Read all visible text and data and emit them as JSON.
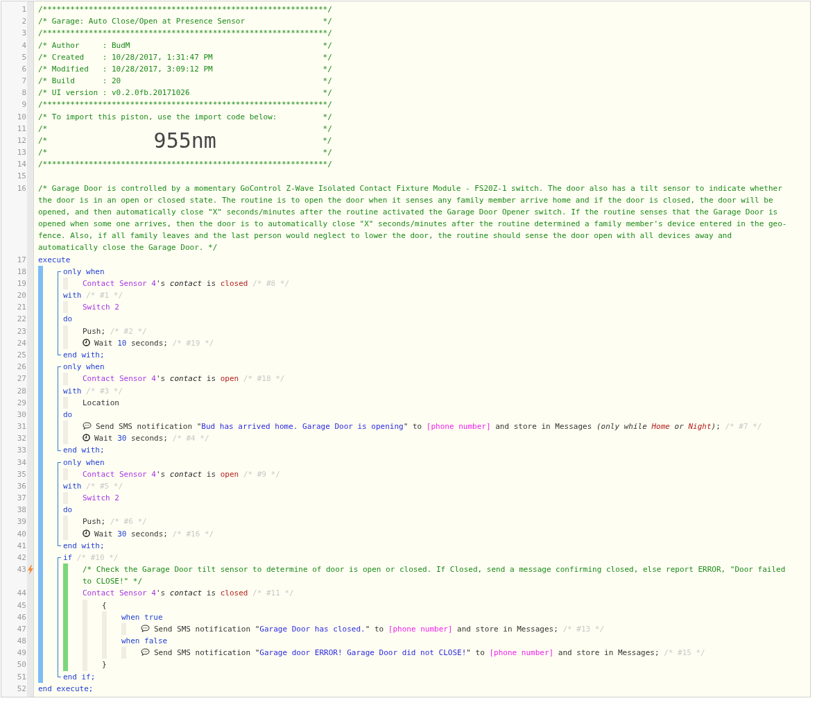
{
  "lines": [
    {
      "number": "1",
      "trigger": false,
      "tokens": [
        {
          "text": "/**************************************************************/",
          "kind": "comment"
        }
      ]
    },
    {
      "number": "2",
      "trigger": false,
      "tokens": [
        {
          "text": "/* Garage: Auto Close/Open at Presence Sensor                 */",
          "kind": "comment"
        }
      ]
    },
    {
      "number": "3",
      "trigger": false,
      "tokens": [
        {
          "text": "/**************************************************************/",
          "kind": "comment"
        }
      ]
    },
    {
      "number": "4",
      "trigger": false,
      "tokens": [
        {
          "text": "/* Author     : BudM                                          */",
          "kind": "comment"
        }
      ]
    },
    {
      "number": "5",
      "trigger": false,
      "tokens": [
        {
          "text": "/* Created    : 10/28/2017, 1:31:47 PM                        */",
          "kind": "comment"
        }
      ]
    },
    {
      "number": "6",
      "trigger": false,
      "tokens": [
        {
          "text": "/* Modified   : 10/28/2017, 3:09:12 PM                        */",
          "kind": "comment"
        }
      ]
    },
    {
      "number": "7",
      "trigger": false,
      "tokens": [
        {
          "text": "/* Build      : 20                                            */",
          "kind": "comment"
        }
      ]
    },
    {
      "number": "8",
      "trigger": false,
      "tokens": [
        {
          "text": "/* UI version : v0.2.0fb.20171026                             */",
          "kind": "comment"
        }
      ]
    },
    {
      "number": "9",
      "trigger": false,
      "tokens": [
        {
          "text": "/**************************************************************/",
          "kind": "comment"
        }
      ]
    },
    {
      "number": "10",
      "trigger": false,
      "tokens": [
        {
          "text": "/* To import this piston, use the import code below:          */",
          "kind": "comment"
        }
      ]
    },
    {
      "number": "11",
      "trigger": false,
      "tokens": [
        {
          "text": "/*                                                            */",
          "kind": "comment"
        }
      ]
    },
    {
      "number": "12",
      "trigger": false,
      "tokens": [
        {
          "text": "/*",
          "kind": "comment"
        },
        {
          "text": "955nm",
          "kind": "code"
        },
        {
          "text": "*/",
          "kind": "comment"
        }
      ]
    },
    {
      "number": "13",
      "trigger": false,
      "tokens": [
        {
          "text": "/*                                                            */",
          "kind": "comment"
        }
      ]
    },
    {
      "number": "14",
      "trigger": false,
      "tokens": [
        {
          "text": "/**************************************************************/",
          "kind": "comment"
        }
      ]
    },
    {
      "number": "15",
      "trigger": false
    },
    {
      "number": "16",
      "trigger": false,
      "tokens": [
        {
          "text": "/* Garage Door is controlled by a momentary GoControl Z-Wave Isolated Contact Fixture Module - FS20Z-1 switch. The door also has a tilt sensor to indicate whether the door is in an open or closed state. The routine is to open the door when it senses any family member arrive home and if the door is closed, the door will be opened, and then automatically close \"X\" seconds/minutes after the routine activated the Garage Door Opener switch. If the routine senses that the Garage Door is opened when some one arrives, then the door is to automatically close \"X\" seconds/minutes after the routine determined a family member's device entered in the geo-fence. Also, if all family leaves and the last person would neglect to lower the door, the routine should sense the door open with all devices away and automatically close the Garage Door. */",
          "kind": "comment"
        }
      ]
    },
    {
      "number": "17",
      "trigger": false,
      "kind": "execute",
      "tokens": [
        {
          "text": "execute",
          "kind": "keyword"
        }
      ],
      "children": [
        {
          "kind": "group",
          "items": [
            {
              "number": "18",
              "trigger": false,
              "kind": "block",
              "tokens": [
                {
                  "text": "only when",
                  "kind": "keyword"
                }
              ],
              "children": [
                {
                  "number": "19",
                  "trigger": false,
                  "tokens": [
                    {
                      "text": "Contact Sensor 4",
                      "kind": "device"
                    },
                    {
                      "text": "'s ",
                      "kind": "text"
                    },
                    {
                      "text": "contact",
                      "kind": "attr"
                    },
                    {
                      "text": " is ",
                      "kind": "text"
                    },
                    {
                      "text": "closed",
                      "kind": "value"
                    },
                    {
                      "text": " /* #8 */",
                      "kind": "note"
                    }
                  ]
                }
              ]
            },
            {
              "number": "20",
              "trigger": false,
              "kind": "block",
              "tokens": [
                {
                  "text": "with",
                  "kind": "keyword"
                },
                {
                  "text": " /* #1 */",
                  "kind": "note"
                }
              ],
              "children": [
                {
                  "number": "21",
                  "trigger": false,
                  "tokens": [
                    {
                      "text": "Switch 2",
                      "kind": "device"
                    }
                  ]
                }
              ]
            },
            {
              "number": "22",
              "trigger": false,
              "kind": "block",
              "tokens": [
                {
                  "text": "do",
                  "kind": "keyword"
                }
              ],
              "children": [
                {
                  "number": "23",
                  "trigger": false,
                  "tokens": [
                    {
                      "text": "Push;",
                      "kind": "text"
                    },
                    {
                      "text": " /* #2 */",
                      "kind": "note"
                    }
                  ]
                },
                {
                  "number": "24",
                  "trigger": false,
                  "tokens": [
                    {
                      "kind": "clock"
                    },
                    {
                      "text": "Wait ",
                      "kind": "text"
                    },
                    {
                      "text": "10",
                      "kind": "number"
                    },
                    {
                      "text": " seconds;",
                      "kind": "text"
                    },
                    {
                      "text": " /* #19 */",
                      "kind": "note"
                    }
                  ]
                }
              ]
            },
            {
              "number": "25",
              "trigger": false,
              "tokens": [
                {
                  "text": "end with;",
                  "kind": "keyword"
                }
              ]
            }
          ]
        },
        {
          "kind": "group",
          "items": [
            {
              "number": "26",
              "trigger": false,
              "kind": "block",
              "tokens": [
                {
                  "text": "only when",
                  "kind": "keyword"
                }
              ],
              "children": [
                {
                  "number": "27",
                  "trigger": false,
                  "tokens": [
                    {
                      "text": "Contact Sensor 4",
                      "kind": "device"
                    },
                    {
                      "text": "'s ",
                      "kind": "text"
                    },
                    {
                      "text": "contact",
                      "kind": "attr"
                    },
                    {
                      "text": " is ",
                      "kind": "text"
                    },
                    {
                      "text": "open",
                      "kind": "value"
                    },
                    {
                      "text": " /* #18 */",
                      "kind": "note"
                    }
                  ]
                }
              ]
            },
            {
              "number": "28",
              "trigger": false,
              "kind": "block",
              "tokens": [
                {
                  "text": "with",
                  "kind": "keyword"
                },
                {
                  "text": " /* #3 */",
                  "kind": "note"
                }
              ],
              "children": [
                {
                  "number": "29",
                  "trigger": false,
                  "tokens": [
                    {
                      "text": "Location",
                      "kind": "text"
                    }
                  ]
                }
              ]
            },
            {
              "number": "30",
              "trigger": false,
              "kind": "block",
              "tokens": [
                {
                  "text": "do",
                  "kind": "keyword"
                }
              ],
              "children": [
                {
                  "number": "31",
                  "trigger": false,
                  "tokens": [
                    {
                      "kind": "chat"
                    },
                    {
                      "text": "Send SMS notification \"",
                      "kind": "text"
                    },
                    {
                      "text": "Bud has arrived home. Garage Door is opening",
                      "kind": "string"
                    },
                    {
                      "text": "\" to ",
                      "kind": "text"
                    },
                    {
                      "text": "[phone number]",
                      "kind": "var"
                    },
                    {
                      "text": " and store in Messages ",
                      "kind": "text"
                    },
                    {
                      "text": "(only while ",
                      "kind": "italic"
                    },
                    {
                      "text": "Home",
                      "kind": "valueItalic"
                    },
                    {
                      "text": " or ",
                      "kind": "italic"
                    },
                    {
                      "text": "Night",
                      "kind": "valueItalic"
                    },
                    {
                      "text": ")",
                      "kind": "italic"
                    },
                    {
                      "text": ";",
                      "kind": "text"
                    },
                    {
                      "text": " /* #7 */",
                      "kind": "note"
                    }
                  ]
                },
                {
                  "number": "32",
                  "trigger": false,
                  "tokens": [
                    {
                      "kind": "clock"
                    },
                    {
                      "text": "Wait ",
                      "kind": "text"
                    },
                    {
                      "text": "30",
                      "kind": "number"
                    },
                    {
                      "text": " seconds;",
                      "kind": "text"
                    },
                    {
                      "text": " /* #4 */",
                      "kind": "note"
                    }
                  ]
                }
              ]
            },
            {
              "number": "33",
              "trigger": false,
              "tokens": [
                {
                  "text": "end with;",
                  "kind": "keyword"
                }
              ]
            }
          ]
        },
        {
          "kind": "group",
          "items": [
            {
              "number": "34",
              "trigger": false,
              "kind": "block",
              "tokens": [
                {
                  "text": "only when",
                  "kind": "keyword"
                }
              ],
              "children": [
                {
                  "number": "35",
                  "trigger": false,
                  "tokens": [
                    {
                      "text": "Contact Sensor 4",
                      "kind": "device"
                    },
                    {
                      "text": "'s ",
                      "kind": "text"
                    },
                    {
                      "text": "contact",
                      "kind": "attr"
                    },
                    {
                      "text": " is ",
                      "kind": "text"
                    },
                    {
                      "text": "open",
                      "kind": "value"
                    },
                    {
                      "text": " /* #9 */",
                      "kind": "note"
                    }
                  ]
                }
              ]
            },
            {
              "number": "36",
              "trigger": false,
              "kind": "block",
              "tokens": [
                {
                  "text": "with",
                  "kind": "keyword"
                },
                {
                  "text": " /* #5 */",
                  "kind": "note"
                }
              ],
              "children": [
                {
                  "number": "37",
                  "trigger": false,
                  "tokens": [
                    {
                      "text": "Switch 2",
                      "kind": "device"
                    }
                  ]
                }
              ]
            },
            {
              "number": "38",
              "trigger": false,
              "kind": "block",
              "tokens": [
                {
                  "text": "do",
                  "kind": "keyword"
                }
              ],
              "children": [
                {
                  "number": "39",
                  "trigger": false,
                  "tokens": [
                    {
                      "text": "Push;",
                      "kind": "text"
                    },
                    {
                      "text": " /* #6 */",
                      "kind": "note"
                    }
                  ]
                },
                {
                  "number": "40",
                  "trigger": false,
                  "tokens": [
                    {
                      "kind": "clock"
                    },
                    {
                      "text": "Wait ",
                      "kind": "text"
                    },
                    {
                      "text": "30",
                      "kind": "number"
                    },
                    {
                      "text": " seconds;",
                      "kind": "text"
                    },
                    {
                      "text": " /* #16 */",
                      "kind": "note"
                    }
                  ]
                }
              ]
            },
            {
              "number": "41",
              "trigger": false,
              "tokens": [
                {
                  "text": "end with;",
                  "kind": "keyword"
                }
              ]
            }
          ]
        },
        {
          "kind": "group",
          "items": [
            {
              "number": "42",
              "trigger": false,
              "kind": "if",
              "tokens": [
                {
                  "text": "if",
                  "kind": "keyword"
                },
                {
                  "text": " /* #10 */",
                  "kind": "note"
                }
              ],
              "children": [
                {
                  "number": "43",
                  "trigger": true,
                  "tokens": [
                    {
                      "text": "/* Check the Garage Door tilt sensor to determine of door is open or closed. If Closed, send a message confirming closed, else report ERROR, \"Door failed to CLOSE!\" */",
                      "kind": "comment"
                    }
                  ]
                },
                {
                  "number": "44",
                  "trigger": false,
                  "kind": "block",
                  "tokens": [
                    {
                      "text": "Contact Sensor 4",
                      "kind": "device"
                    },
                    {
                      "text": "'s ",
                      "kind": "text"
                    },
                    {
                      "text": "contact",
                      "kind": "attr"
                    },
                    {
                      "text": " is ",
                      "kind": "text"
                    },
                    {
                      "text": "closed",
                      "kind": "value"
                    },
                    {
                      "text": " /* #11 */",
                      "kind": "note"
                    }
                  ],
                  "children": [
                    {
                      "number": "45",
                      "trigger": false,
                      "kind": "block",
                      "tokens": [
                        {
                          "text": "{",
                          "kind": "text"
                        }
                      ],
                      "children": [
                        {
                          "number": "46",
                          "trigger": false,
                          "kind": "block",
                          "tokens": [
                            {
                              "text": "when true",
                              "kind": "keyword"
                            }
                          ],
                          "children": [
                            {
                              "number": "47",
                              "trigger": false,
                              "tokens": [
                                {
                                  "kind": "chat"
                                },
                                {
                                  "text": "Send SMS notification \"",
                                  "kind": "text"
                                },
                                {
                                  "text": "Garage Door has closed.",
                                  "kind": "string"
                                },
                                {
                                  "text": "\" to ",
                                  "kind": "text"
                                },
                                {
                                  "text": "[phone number]",
                                  "kind": "var"
                                },
                                {
                                  "text": " and store in Messages;",
                                  "kind": "text"
                                },
                                {
                                  "text": " /* #13 */",
                                  "kind": "note"
                                }
                              ]
                            }
                          ]
                        },
                        {
                          "number": "48",
                          "trigger": false,
                          "kind": "block",
                          "tokens": [
                            {
                              "text": "when false",
                              "kind": "keyword"
                            }
                          ],
                          "children": [
                            {
                              "number": "49",
                              "trigger": false,
                              "tokens": [
                                {
                                  "kind": "chat"
                                },
                                {
                                  "text": "Send SMS notification \"",
                                  "kind": "text"
                                },
                                {
                                  "text": "Garage door ERROR! Garage Door did not CLOSE!",
                                  "kind": "string"
                                },
                                {
                                  "text": "\" to ",
                                  "kind": "text"
                                },
                                {
                                  "text": "[phone number]",
                                  "kind": "var"
                                },
                                {
                                  "text": " and store in Messages;",
                                  "kind": "text"
                                },
                                {
                                  "text": " /* #15 */",
                                  "kind": "note"
                                }
                              ]
                            }
                          ]
                        }
                      ]
                    },
                    {
                      "number": "50",
                      "trigger": false,
                      "tokens": [
                        {
                          "text": "}",
                          "kind": "text"
                        }
                      ]
                    }
                  ]
                }
              ]
            },
            {
              "number": "51",
              "trigger": false,
              "tokens": [
                {
                  "text": "end if;",
                  "kind": "keyword"
                }
              ]
            }
          ]
        }
      ]
    },
    {
      "number": "52",
      "trigger": false,
      "tokens": [
        {
          "text": "end execute;",
          "kind": "keyword"
        }
      ]
    }
  ]
}
